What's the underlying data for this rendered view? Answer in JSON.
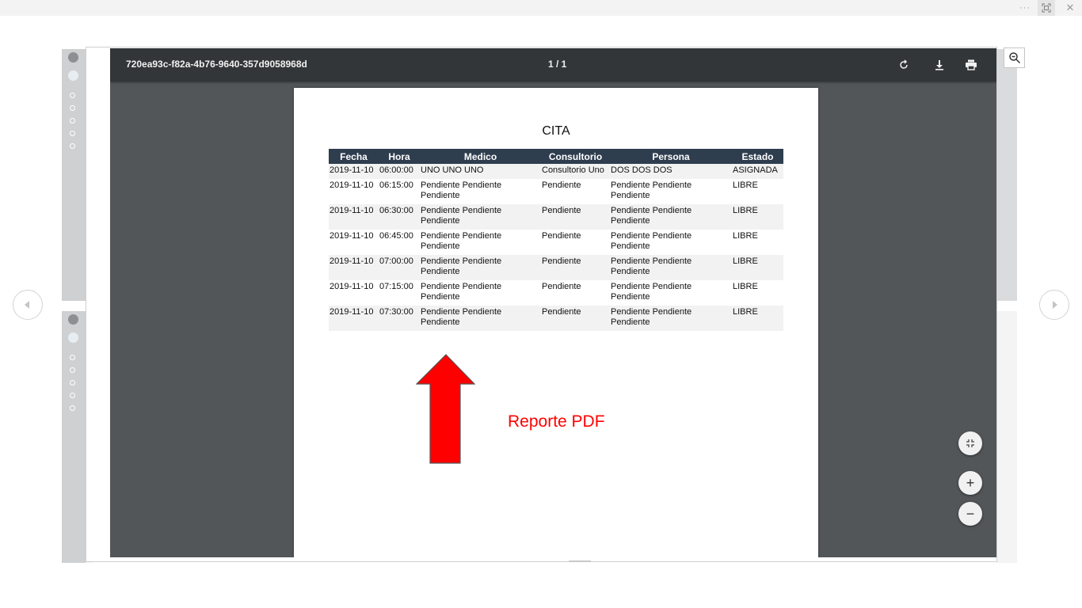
{
  "viewer": {
    "window_controls": {
      "more": "···",
      "fit": "⛶",
      "close": "✕"
    }
  },
  "pdf": {
    "filename": "720ea93c-f82a-4b76-9640-357d9058968d",
    "page_indicator": "1 / 1",
    "toolbar_icons": [
      "rotate-icon",
      "download-icon",
      "print-icon"
    ],
    "zoom_controls": {
      "fit": "fit-page-icon",
      "zoom_in": "+",
      "zoom_out": "−"
    }
  },
  "document": {
    "title": "CITA",
    "columns": [
      "Fecha",
      "Hora",
      "Medico",
      "Consultorio",
      "Persona",
      "Estado"
    ],
    "rows": [
      {
        "fecha": "2019-11-10",
        "hora": "06:00:00",
        "medico": "UNO UNO UNO",
        "consultorio": "Consultorio Uno",
        "persona": "DOS DOS DOS",
        "estado": "ASIGNADA"
      },
      {
        "fecha": "2019-11-10",
        "hora": "06:15:00",
        "medico": "Pendiente Pendiente Pendiente",
        "consultorio": "Pendiente",
        "persona": "Pendiente Pendiente Pendiente",
        "estado": "LIBRE"
      },
      {
        "fecha": "2019-11-10",
        "hora": "06:30:00",
        "medico": "Pendiente Pendiente Pendiente",
        "consultorio": "Pendiente",
        "persona": "Pendiente Pendiente Pendiente",
        "estado": "LIBRE"
      },
      {
        "fecha": "2019-11-10",
        "hora": "06:45:00",
        "medico": "Pendiente Pendiente Pendiente",
        "consultorio": "Pendiente",
        "persona": "Pendiente Pendiente Pendiente",
        "estado": "LIBRE"
      },
      {
        "fecha": "2019-11-10",
        "hora": "07:00:00",
        "medico": "Pendiente Pendiente Pendiente",
        "consultorio": "Pendiente",
        "persona": "Pendiente Pendiente Pendiente",
        "estado": "LIBRE"
      },
      {
        "fecha": "2019-11-10",
        "hora": "07:15:00",
        "medico": "Pendiente Pendiente Pendiente",
        "consultorio": "Pendiente",
        "persona": "Pendiente Pendiente Pendiente",
        "estado": "LIBRE"
      },
      {
        "fecha": "2019-11-10",
        "hora": "07:30:00",
        "medico": "Pendiente Pendiente Pendiente",
        "consultorio": "Pendiente",
        "persona": "Pendiente Pendiente Pendiente",
        "estado": "LIBRE"
      }
    ]
  },
  "annotation": {
    "label": "Reporte PDF",
    "color": "#ff0000"
  },
  "colors": {
    "toolbar": "#323639",
    "viewer_bg": "#525659",
    "table_header": "#2e3e4f"
  }
}
